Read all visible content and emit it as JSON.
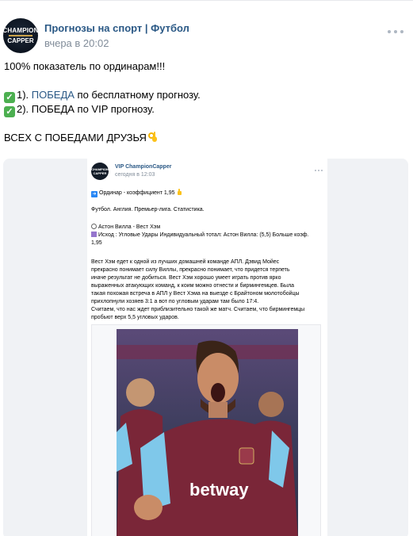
{
  "post": {
    "author": "Прогнозы на спорт | Футбол",
    "time": "вчера в 20:02",
    "avatar": {
      "line1": "CHAMPION",
      "line2": "CAPPER"
    },
    "text": {
      "line1": "100% показатель по ординарам!!!",
      "line2_prefix": "1). ",
      "line2_link": "ПОБЕДА",
      "line2_suffix": " по бесплатному прогнозу.",
      "line3": "2). ПОБЕДА по VIP прогнозу.",
      "line4": "ВСЕХ С ПОБЕДАМИ ДРУЗЬЯ"
    },
    "icons": {
      "check": "check-mark-icon",
      "ok": "ok-hand-emoji-icon",
      "more": "more-dots-icon"
    }
  },
  "inner_post": {
    "author": "VIP ChampionCapper",
    "time": "сегодня в 12:03",
    "avatar": {
      "line1": "CHAMPION",
      "line2": "CAPPER"
    },
    "ordinar": "Ординар - коэффициент 1,95",
    "league": "Футбол. Англия. Премьер-лига. Статистика.",
    "match": "Астон Вилла - Вест Хэм",
    "outcome_line1": "Исход : Угловые Удары Индивидуальный тотал: Астон Вилла: (5,5) Больше коэф.",
    "outcome_line2": "1,95",
    "analysis": [
      "Вест Хэм едет к одной из лучших домашней команде АПЛ. Дэвид Мойес",
      "прекрасно понимает силу Виллы, прекрасно понимает, что придется терпеть",
      "иначе результат не добиться. Вест Хэм хорошо умеет играть против ярко",
      "выраженных атакующих команд, к коим можно отнести и бирмингемцев. Была",
      "такая похожая встреча в АПЛ у Вест Хэма на выезде с Брайтоном молотобойцы",
      "прихлопнули хозяев 3:1 а вот по угловым ударам там было 17:4.",
      "Считаем, что нас ждет приблизительно такой же матч. Считаем, что бирмингемцы",
      "пробьют верх 5,5 угловых ударов."
    ],
    "photo": {
      "sponsor": "betway"
    }
  },
  "colors": {
    "link": "#2a5885",
    "meta": "#818c99",
    "check": "#4caf50",
    "kit": "#7a2638",
    "sleeve": "#7fc8ea"
  }
}
